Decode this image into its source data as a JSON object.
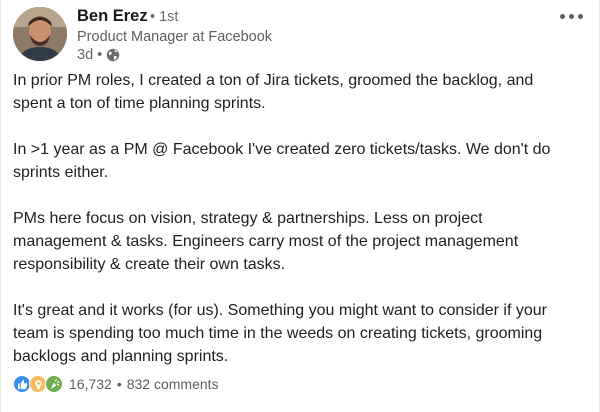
{
  "author": {
    "name": "Ben Erez",
    "degree": "• 1st",
    "headline": "Product Manager at Facebook",
    "time": "3d •",
    "visibility_icon": "globe-icon"
  },
  "menu_icon": "more-horizontal-icon",
  "post": {
    "paragraphs": [
      "In prior PM roles, I created a ton of Jira tickets, groomed the backlog, and\nspent a ton of time planning sprints.",
      "In >1 year as a PM @ Facebook I've created zero tickets/tasks. We don't do\nsprints either.",
      "PMs here focus on vision, strategy & partnerships. Less on project\nmanagement & tasks. Engineers carry most of the project management\nresponsibility & create their own tasks.",
      "It's great and it works (for us). Something you might want to consider if your\nteam is spending too much time in the weeds on creating tickets, grooming\nbacklogs and planning sprints."
    ]
  },
  "social": {
    "reaction_icons": [
      "like-icon",
      "insightful-icon",
      "celebrate-icon"
    ],
    "reaction_count": "16,732",
    "separator": "•",
    "comments": "832 comments"
  },
  "colors": {
    "like": "#378fe9",
    "insightful": "#f5bb5c",
    "celebrate": "#6dae4f"
  }
}
